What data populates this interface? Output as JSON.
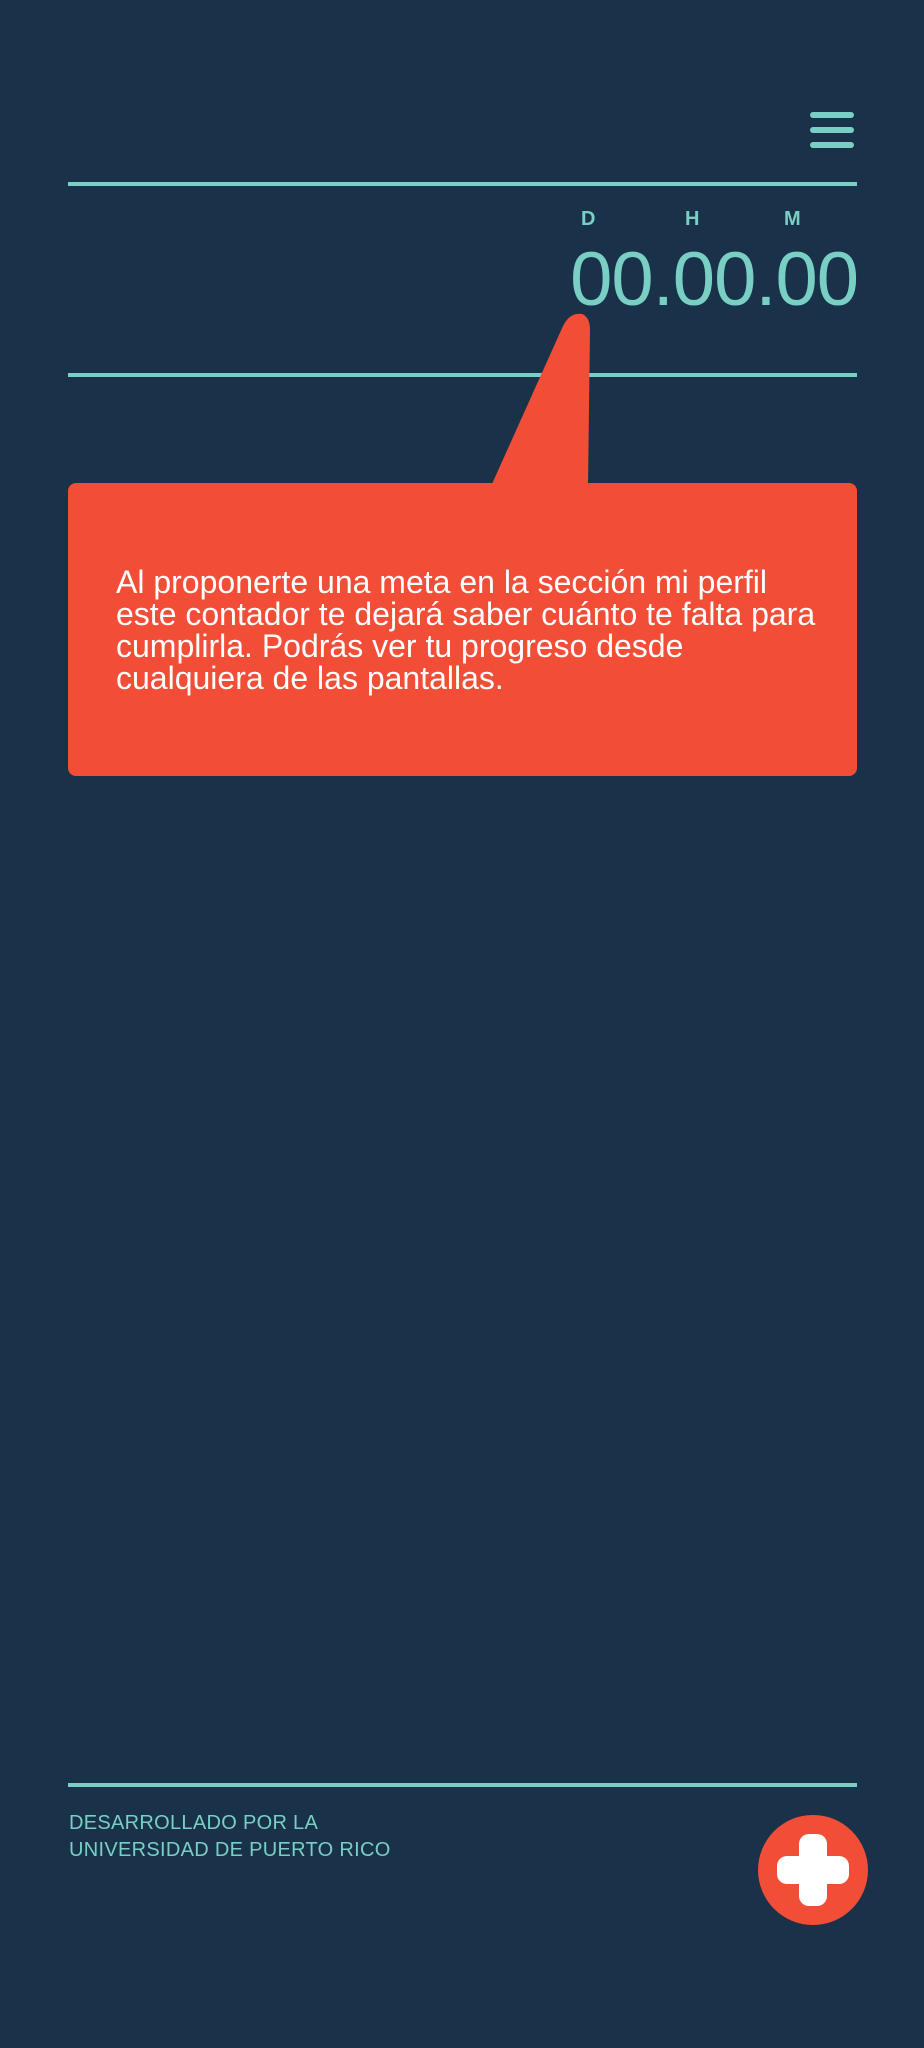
{
  "header": {
    "menu_icon": "hamburger-menu-icon"
  },
  "timer": {
    "labels": {
      "days": "D",
      "hours": "H",
      "minutes": "M"
    },
    "value": "00.00.00"
  },
  "tooltip": {
    "text": "Al proponerte una meta en la sección mi perfil este contador te dejará saber cuánto te falta para cumplirla. Podrás ver tu progreso desde cualquiera de las pantallas."
  },
  "footer": {
    "credit_line1": "DESARROLLADO POR LA",
    "credit_line2": "UNIVERSIDAD DE PUERTO RICO",
    "add_icon": "plus-icon"
  },
  "colors": {
    "background": "#19324a",
    "accent_teal": "#79cfc3",
    "accent_red": "#f24d36",
    "text_white": "#ffffff"
  }
}
